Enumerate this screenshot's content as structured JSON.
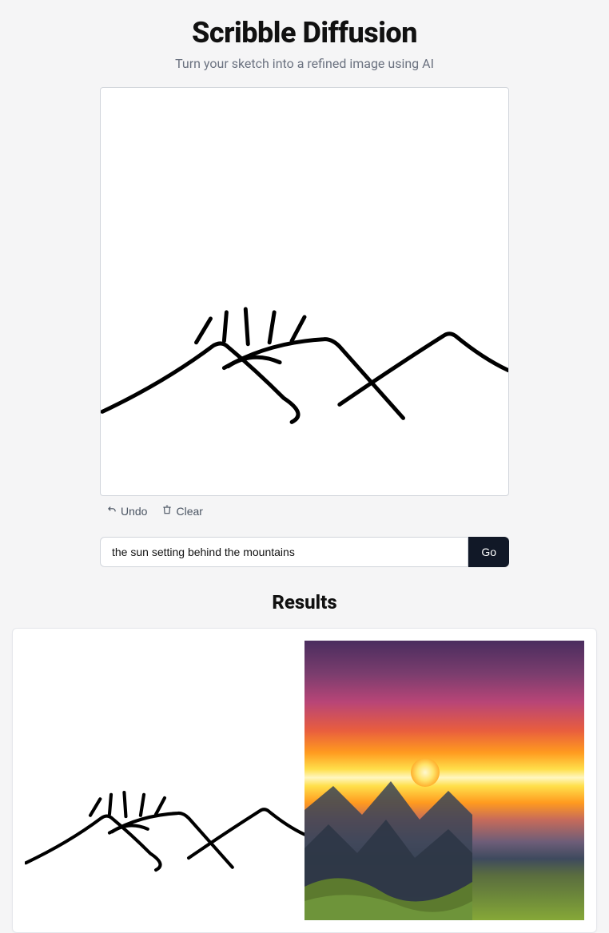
{
  "header": {
    "title": "Scribble Diffusion",
    "subtitle": "Turn your sketch into a refined image using AI"
  },
  "canvas": {
    "undo_label": "Undo",
    "clear_label": "Clear"
  },
  "prompt": {
    "value": "the sun setting behind the mountains",
    "go_label": "Go"
  },
  "results": {
    "heading": "Results"
  }
}
